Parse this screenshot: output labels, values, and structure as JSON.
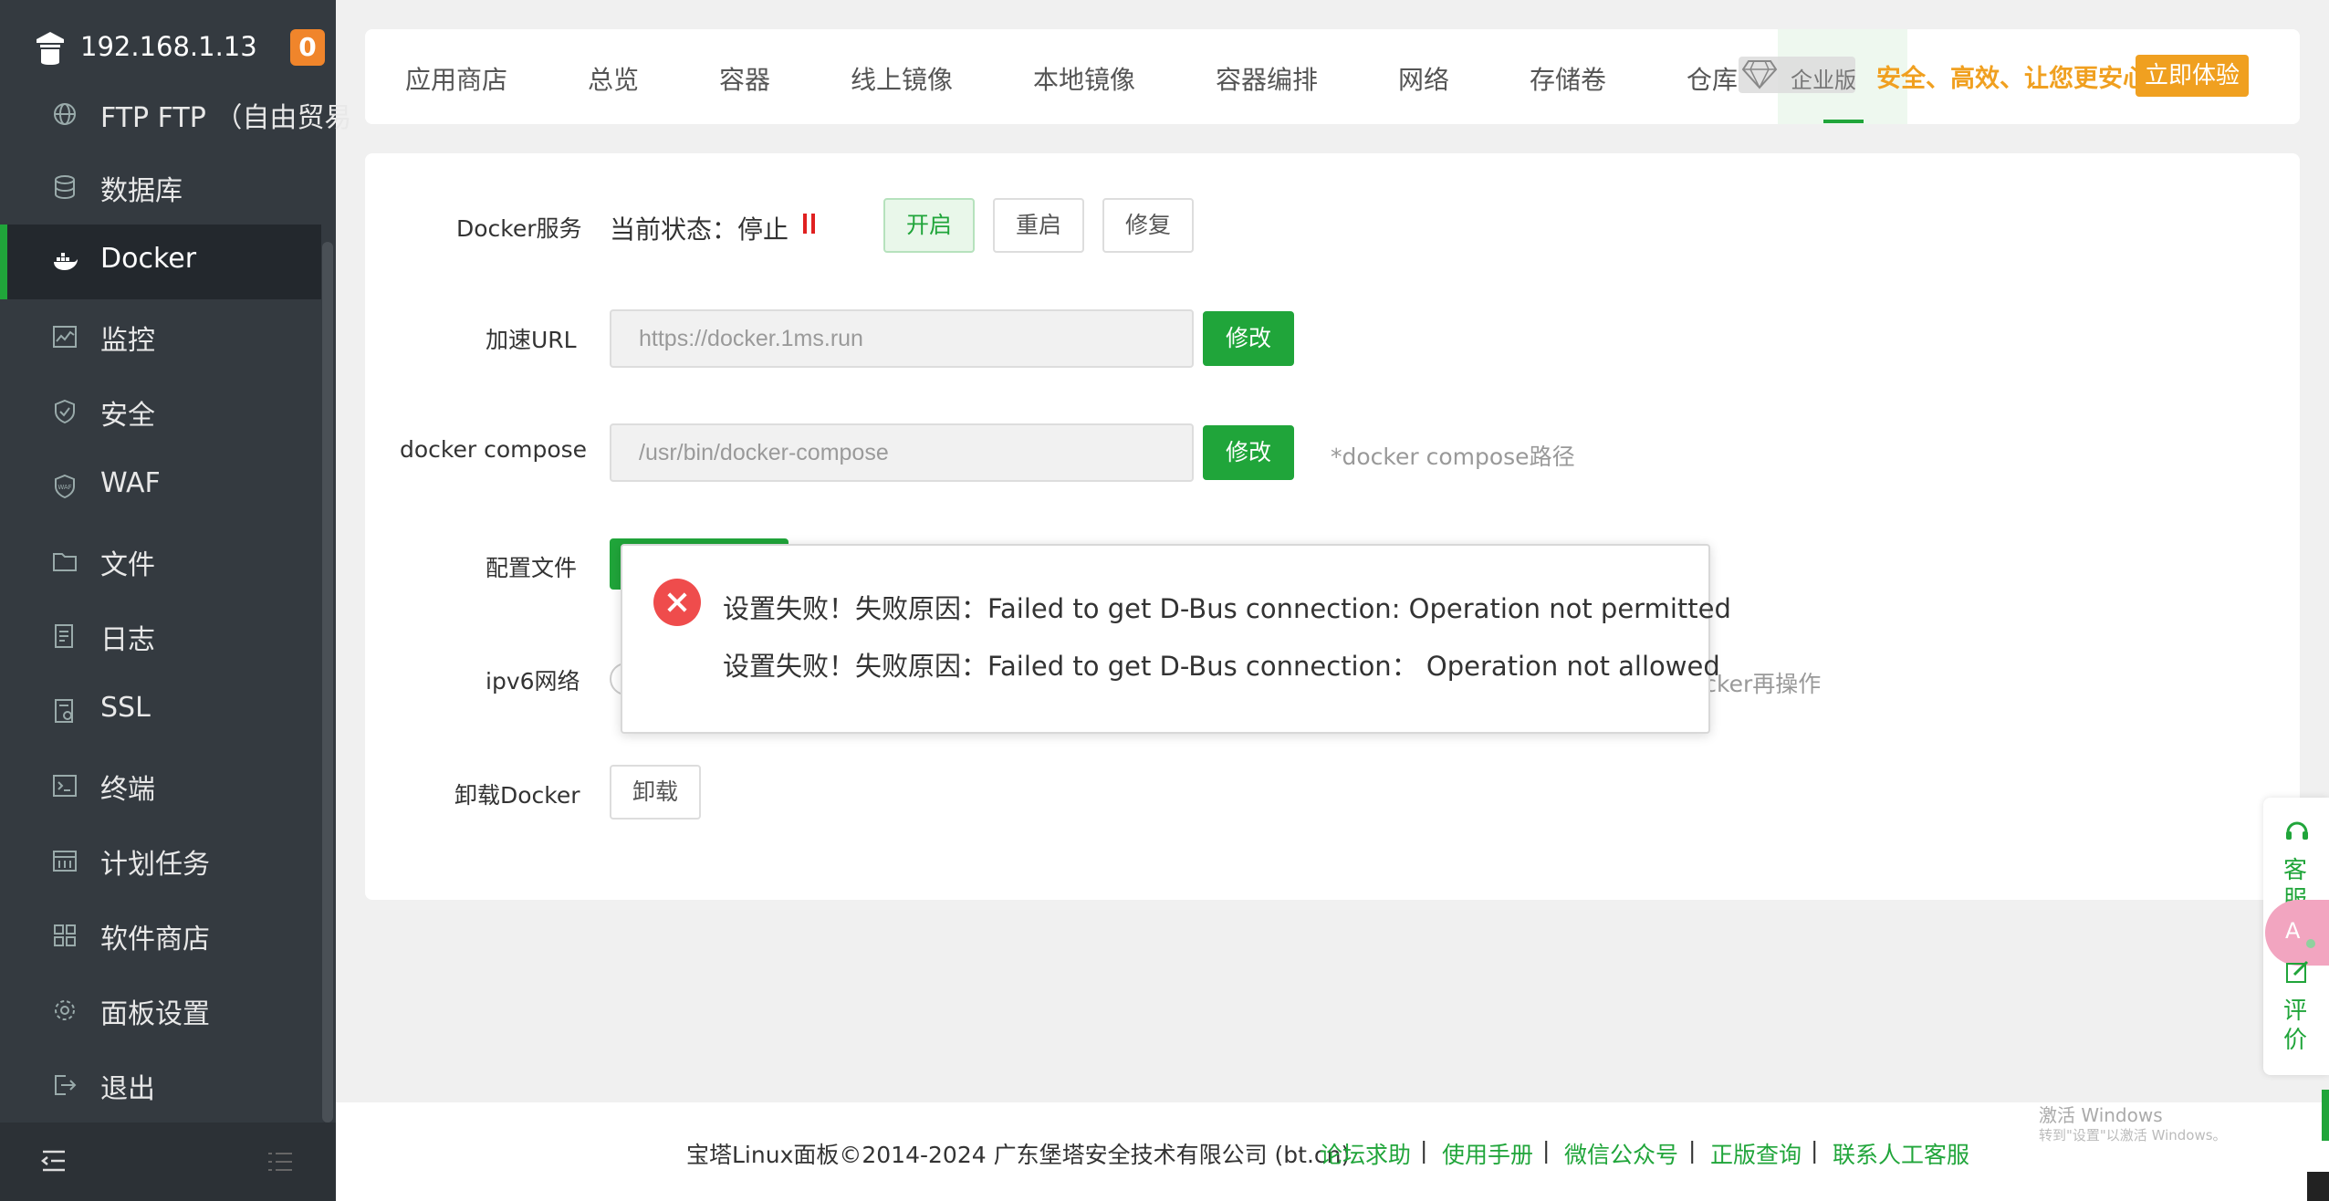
{
  "sidebar": {
    "host": "192.168.1.13",
    "badge": "0",
    "items": [
      {
        "label": "FTP FTP （自由贸易",
        "icon": "globe-icon"
      },
      {
        "label": "数据库",
        "icon": "database-icon"
      },
      {
        "label": "Docker",
        "icon": "docker-icon",
        "active": true
      },
      {
        "label": "监控",
        "icon": "monitor-icon"
      },
      {
        "label": "安全",
        "icon": "shield-icon"
      },
      {
        "label": "WAF",
        "icon": "waf-shield-icon"
      },
      {
        "label": "文件",
        "icon": "folder-icon"
      },
      {
        "label": "日志",
        "icon": "log-icon"
      },
      {
        "label": "SSL",
        "icon": "certificate-icon"
      },
      {
        "label": "终端",
        "icon": "terminal-icon"
      },
      {
        "label": "计划任务",
        "icon": "calendar-icon"
      },
      {
        "label": "软件商店",
        "icon": "apps-grid-icon"
      },
      {
        "label": "面板设置",
        "icon": "gear-icon"
      },
      {
        "label": "退出",
        "icon": "logout-icon"
      }
    ]
  },
  "tabs": [
    "应用商店",
    "总览",
    "容器",
    "线上镜像",
    "本地镜像",
    "容器编排",
    "网络",
    "存储卷",
    "仓库"
  ],
  "promo": {
    "edition": "企业版",
    "slogan": "安全、高效、让您更安心",
    "try_label": "立即体验"
  },
  "form": {
    "service_label": "Docker服务",
    "status_text": "当前状态：停止",
    "start_label": "开启",
    "restart_label": "重启",
    "repair_label": "修复",
    "mirror_label": "加速URL",
    "mirror_placeholder": "https://docker.1ms.run",
    "modify_label": "修改",
    "compose_label": "docker compose",
    "compose_placeholder": "/usr/bin/docker-compose",
    "compose_hint": "*docker compose路径",
    "config_label": "配置文件",
    "ipv6_label": "ipv6网络",
    "ipv6_hint": "ocker再操作",
    "uninstall_label": "卸载Docker",
    "uninstall_button": "卸载"
  },
  "dialog": {
    "line1": "设置失败！失败原因：Failed to get D-Bus connection: Operation not permitted",
    "line2": "设置失败！失败原因：Failed to get D-Bus connection：  Operation not allowed"
  },
  "footer": {
    "copyright": "宝塔Linux面板©2014-2024 广东堡塔安全技术有限公司 (bt.cn)",
    "links": [
      "论坛求助",
      "使用手册",
      "微信公众号",
      "正版查询",
      "联系人工客服"
    ],
    "separator": "|"
  },
  "float_panel": {
    "service": "客服",
    "review": "评价"
  },
  "watermark": {
    "line1": "激活 Windows",
    "line2": "转到\"设置\"以激活 Windows。"
  },
  "colors": {
    "brand_green": "#20a53a",
    "sidebar_bg": "#343a40",
    "badge_orange": "#f0852b",
    "promo_gold": "#f0a020",
    "error_red": "#ef4c4c"
  }
}
